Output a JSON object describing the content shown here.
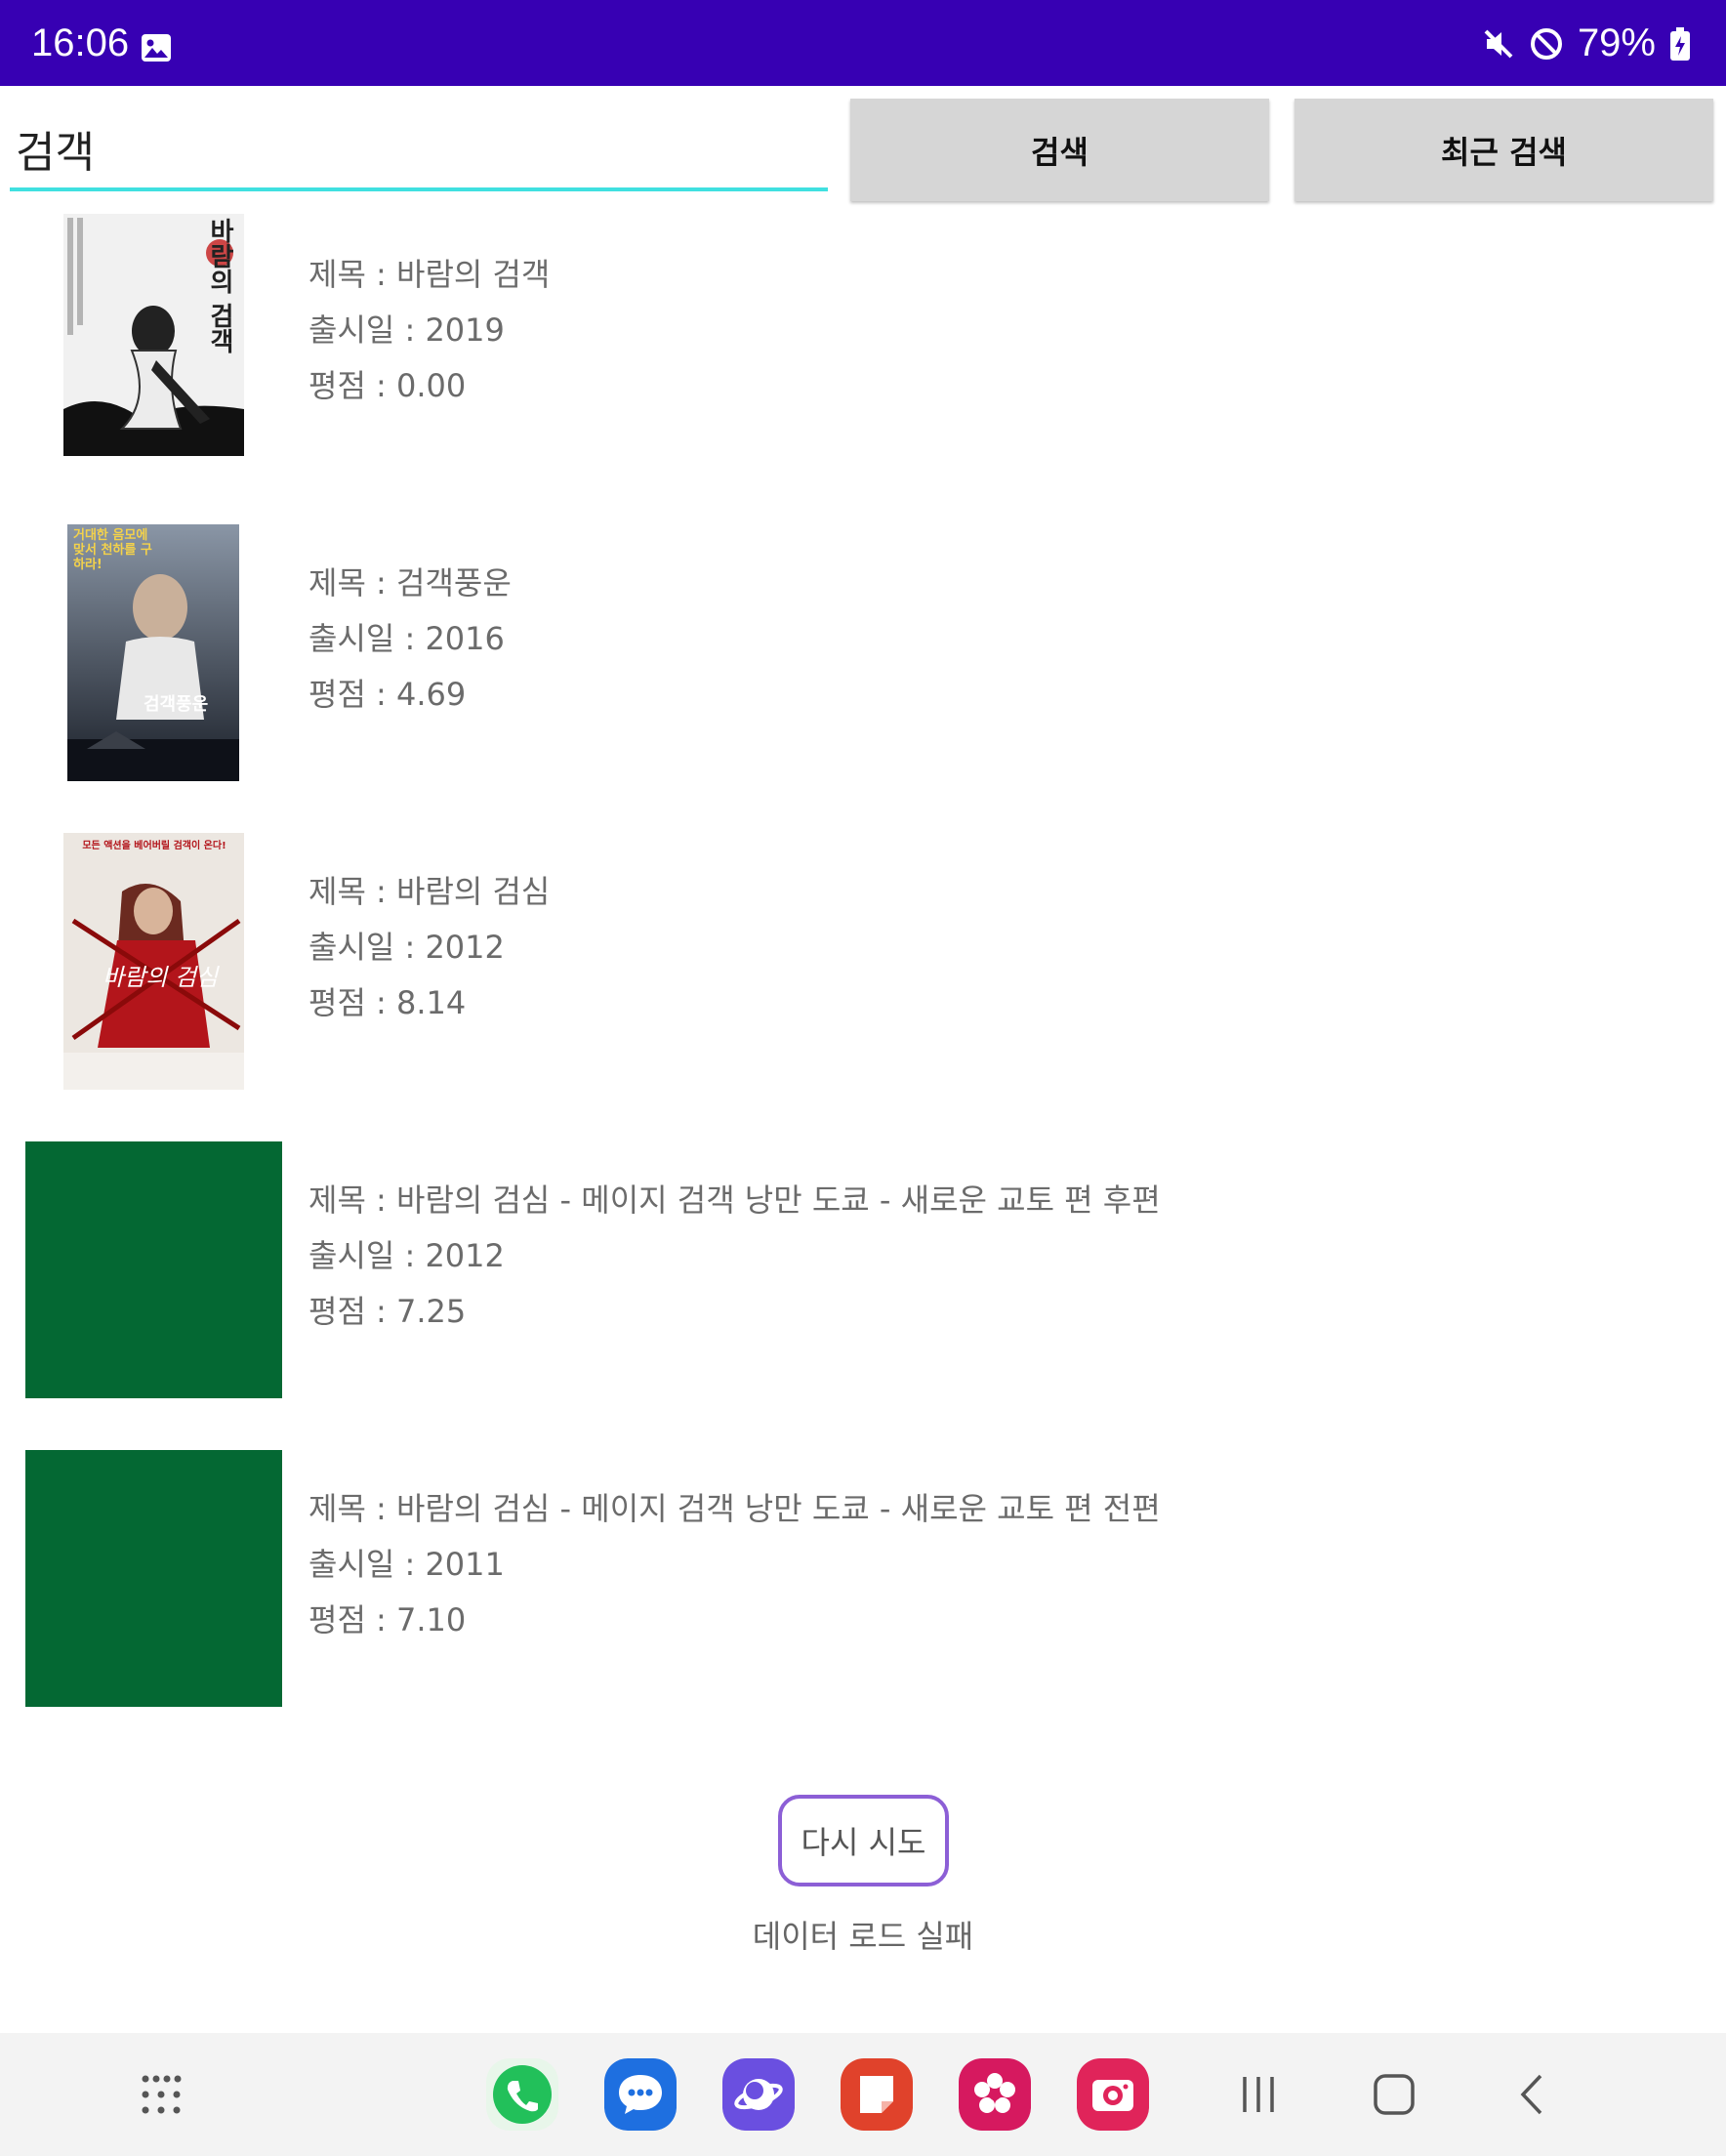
{
  "status_bar": {
    "time": "16:06",
    "battery": "79%"
  },
  "search": {
    "query": "검객",
    "search_label": "검색",
    "recent_label": "최근 검색"
  },
  "results": [
    {
      "title": "제목 : 바람의 검객",
      "release": "출시일 : 2019",
      "rating": "평점 : 0.00",
      "poster_text": "바람의 검객"
    },
    {
      "title": "제목 : 검객풍운",
      "release": "출시일 : 2016",
      "rating": "평점 : 4.69",
      "poster_text": "검객풍운",
      "poster_tag": "거대한 음모에 맞서 천하를 구하라!"
    },
    {
      "title": "제목 : 바람의 검심",
      "release": "출시일 : 2012",
      "rating": "평점 : 8.14",
      "poster_text": "바람의 검심",
      "poster_tag": "모든 액션을 베어버릴 검객이 온다!"
    },
    {
      "title": "제목 : 바람의 검심 - 메이지 검객 낭만 도쿄 - 새로운 교토 편 후편",
      "release": "출시일 : 2012",
      "rating": "평점 : 7.25"
    },
    {
      "title": "제목 : 바람의 검심 - 메이지 검객 낭만 도쿄 - 새로운 교토 편 전편",
      "release": "출시일 : 2011",
      "rating": "평점 : 7.10"
    }
  ],
  "footer": {
    "retry_label": "다시 시도",
    "error_text": "데이터 로드 실패"
  },
  "colors": {
    "status_bar": "#3700b3",
    "accent_underline": "#40e0e0",
    "placeholder_poster": "#046833",
    "retry_border": "#8c5fd6"
  }
}
